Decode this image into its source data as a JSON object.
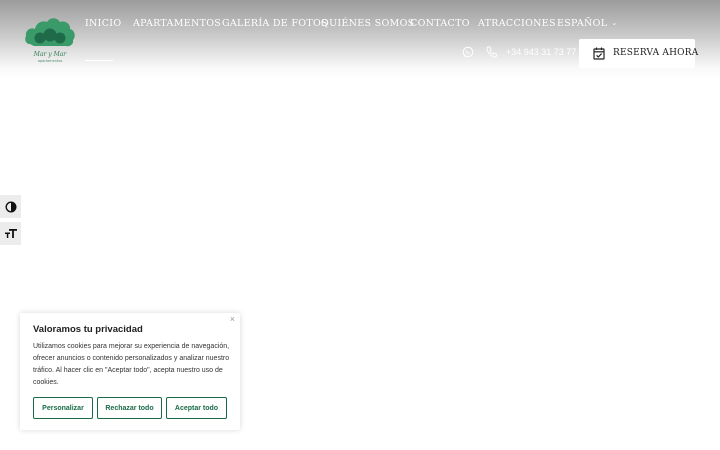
{
  "header": {
    "logo": {
      "icon": "cloud-leaf-logo",
      "brand_text": "Mar y Mar",
      "sub_text": "apartamentos"
    },
    "nav": [
      {
        "label": "INICIO"
      },
      {
        "label": "APARTAMENTOS"
      },
      {
        "label": "GALERÍA DE FOTOS"
      },
      {
        "label": "QUIÉNES SOMOS"
      },
      {
        "label": "CONTACTO"
      },
      {
        "label": "ATRACCIONES"
      },
      {
        "label": "ESPAÑOL",
        "caret": "⌄"
      }
    ],
    "contact": {
      "whatsapp_icon": "whatsapp-icon",
      "phone_icon": "phone-icon",
      "phone": "+34 943 31 73 77"
    },
    "book_button": {
      "icon": "calendar-check-icon",
      "label": "RESERVA AHORA"
    }
  },
  "accessibility": {
    "contrast_icon": "contrast-toggle-icon",
    "font_icon": "font-size-icon"
  },
  "cookie_banner": {
    "title": "Valoramos tu privacidad",
    "body": "Utilizamos cookies para mejorar su experiencia de navegación, ofrecer anuncios o contenido personalizados y analizar nuestro tráfico. Al hacer clic en \"Aceptar todo\", acepta nuestro uso de cookies.",
    "close": "×",
    "buttons": {
      "customize": "Personalizar",
      "reject": "Rechazar todo",
      "accept": "Aceptar todo"
    }
  },
  "colors": {
    "brand_green": "#1a6b48",
    "logo_green": "#2f8a5e"
  }
}
